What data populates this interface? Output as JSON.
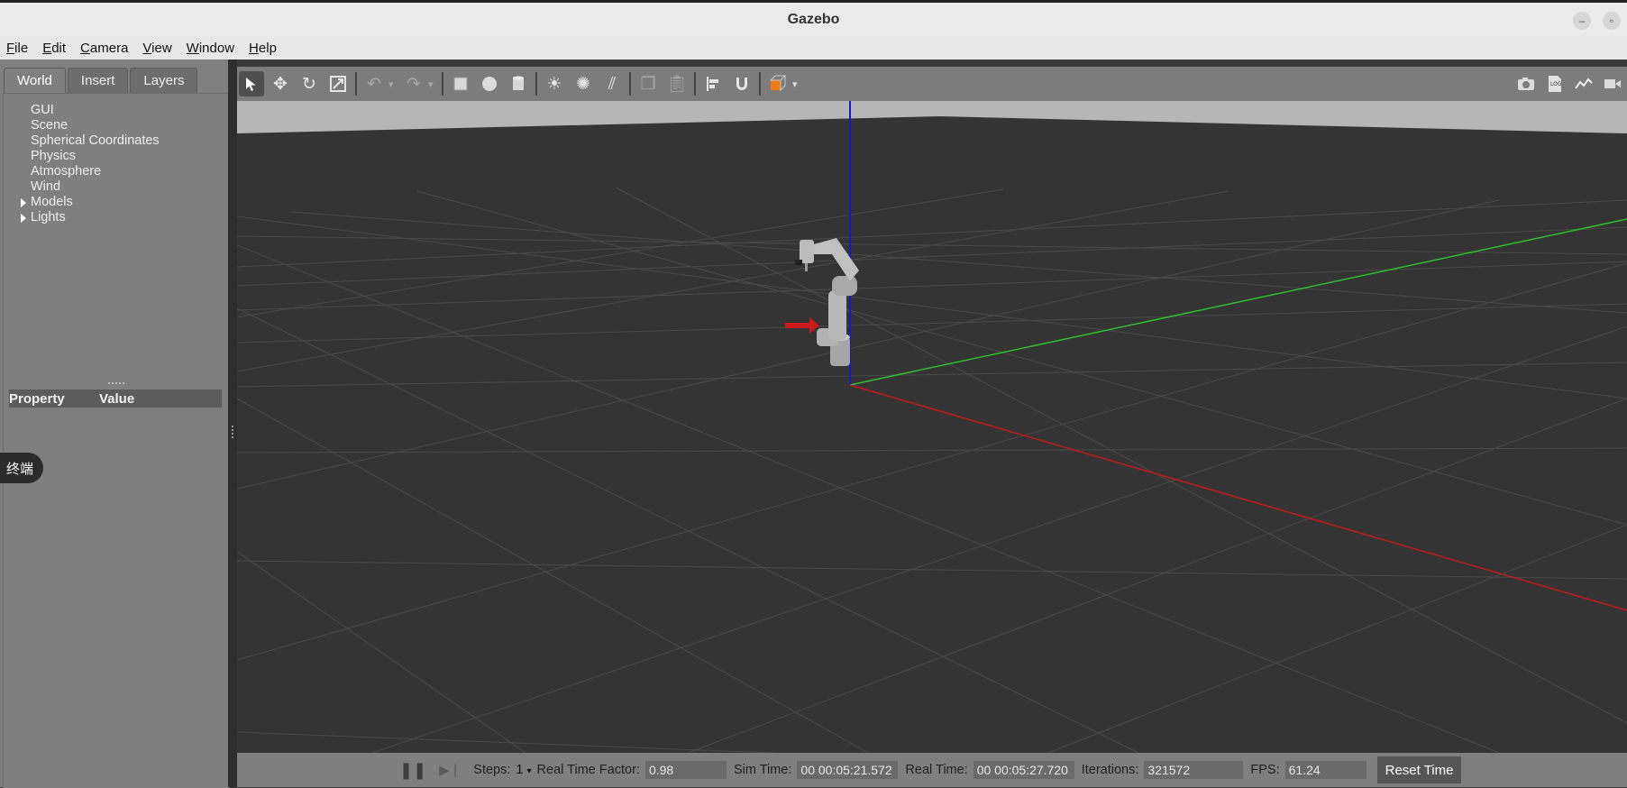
{
  "window": {
    "title": "Gazebo"
  },
  "menu": [
    {
      "label": "File",
      "accel": "F",
      "rest": "ile"
    },
    {
      "label": "Edit",
      "accel": "E",
      "rest": "dit"
    },
    {
      "label": "Camera",
      "accel": "C",
      "rest": "amera"
    },
    {
      "label": "View",
      "accel": "V",
      "rest": "iew"
    },
    {
      "label": "Window",
      "accel": "W",
      "rest": "indow"
    },
    {
      "label": "Help",
      "accel": "H",
      "rest": "elp"
    }
  ],
  "left_panel": {
    "tabs": [
      "World",
      "Insert",
      "Layers"
    ],
    "active_tab": "World",
    "tree": [
      "GUI",
      "Scene",
      "Spherical Coordinates",
      "Physics",
      "Atmosphere",
      "Wind",
      "Models",
      "Lights"
    ],
    "property_header": {
      "property": "Property",
      "value": "Value"
    },
    "terminal_badge": "终端"
  },
  "toolbar": {
    "tools": [
      "select-mode",
      "translate-mode",
      "rotate-mode",
      "scale-mode",
      "undo",
      "redo",
      "box",
      "sphere",
      "cylinder",
      "point-light",
      "spot-light",
      "directional-light",
      "copy",
      "paste",
      "align",
      "snap",
      "view-angle"
    ],
    "right_tools": [
      "screenshot",
      "log",
      "plot",
      "video-record"
    ]
  },
  "colors": {
    "x_axis": "#c21a1a",
    "y_axis": "#2fbf2f",
    "z_axis": "#1818c0",
    "ground": "#343434",
    "sky": "#b4b4b4"
  },
  "bottom_bar": {
    "steps_label": "Steps:",
    "steps_value": "1",
    "rtf_label": "Real Time Factor:",
    "rtf_value": "0.98",
    "sim_time_label": "Sim Time:",
    "sim_time_value": "00 00:05:21.572",
    "real_time_label": "Real Time:",
    "real_time_value": "00 00:05:27.720",
    "iterations_label": "Iterations:",
    "iterations_value": "321572",
    "fps_label": "FPS:",
    "fps_value": "61.24",
    "reset_label": "Reset Time"
  }
}
